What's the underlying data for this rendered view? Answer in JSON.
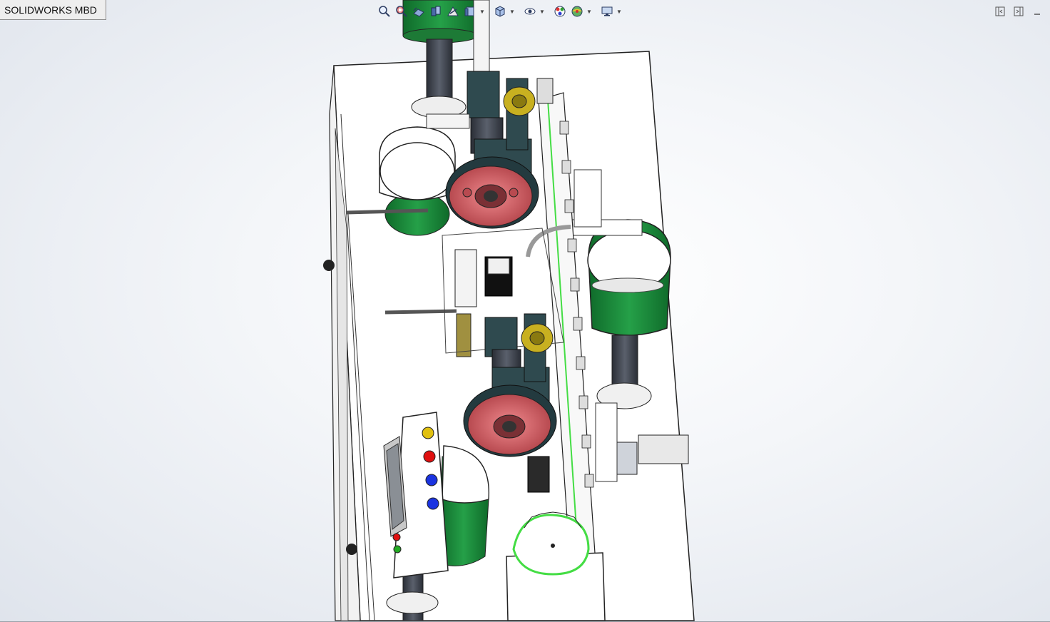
{
  "tab": {
    "label": "SOLIDWORKS MBD"
  },
  "toolbar": {
    "items": [
      {
        "icon": "zoom-to-fit-icon"
      },
      {
        "icon": "zoom-to-area-icon"
      },
      {
        "icon": "previous-view-icon"
      },
      {
        "icon": "section-view-icon"
      },
      {
        "icon": "dynamic-annotation-icon"
      },
      {
        "icon": "view-orientation-icon"
      },
      {
        "icon": "display-style-icon"
      },
      {
        "icon": "hide-show-items-icon"
      },
      {
        "icon": "edit-appearance-icon"
      },
      {
        "icon": "apply-scene-icon"
      },
      {
        "icon": "view-settings-icon"
      }
    ]
  },
  "window_controls": [
    {
      "icon": "tile-left-icon"
    },
    {
      "icon": "tile-right-icon"
    },
    {
      "icon": "minimize-icon"
    }
  ],
  "colors": {
    "pulley": "#d9696e",
    "motor_housing": "#2f4a4f",
    "bowl_green": "#1a8a3a",
    "frame_white": "#ffffff",
    "belt_green": "#44dd44",
    "button_red": "#e01010",
    "button_blue": "#1a33e0",
    "button_yellow": "#e0c010"
  }
}
